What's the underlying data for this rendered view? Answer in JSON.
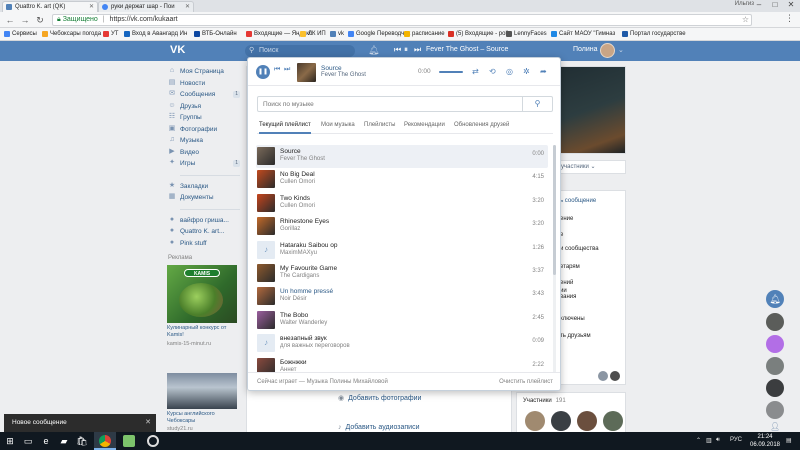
{
  "browser": {
    "tabs": [
      {
        "label": "Quattro K. art (QK)",
        "color": "#5181b8"
      },
      {
        "label": "руки держат шар - Пои",
        "color": "#4285f4"
      }
    ],
    "window_user": "Ильгиз",
    "back_icon": "arrow-left-icon",
    "address": {
      "secure_label": "Защищено",
      "url": "https://vk.com/kukaart"
    },
    "bookmarks": [
      {
        "label": "Сервисы",
        "color": "#4285f4"
      },
      {
        "label": "Чебоксары погода",
        "color": "#f5a623"
      },
      {
        "label": "УТ",
        "color": "#e53935"
      },
      {
        "label": "Вход в Авангард Ин",
        "color": "#1565c0"
      },
      {
        "label": "ВТБ-Онлайн",
        "color": "#0d47a1"
      },
      {
        "label": "Входящие — Яндекс",
        "color": "#e53935"
      },
      {
        "label": "ЛК ИП",
        "color": "#fbc02d"
      },
      {
        "label": "vk",
        "color": "#5181b8"
      },
      {
        "label": "Google Переводчик",
        "color": "#4285f4"
      },
      {
        "label": "расписание",
        "color": "#f4b400"
      },
      {
        "label": "(5) Входящие - polin",
        "color": "#d93025"
      },
      {
        "label": "LennyFaces",
        "color": "#555555"
      },
      {
        "label": "Сайт МАОУ \"Гимназ",
        "color": "#1e88e5"
      },
      {
        "label": "Портал государстве",
        "color": "#1e5aa8"
      }
    ]
  },
  "vk_header": {
    "logo": "VK",
    "search_placeholder": "Поиск",
    "now_playing": "Fever The Ghost – Source",
    "user_name": "Полина"
  },
  "left_menu": {
    "items": [
      {
        "label": "Моя Страница",
        "icon": "home-icon",
        "glyph": "⌂",
        "count": ""
      },
      {
        "label": "Новости",
        "icon": "news-icon",
        "glyph": "▤",
        "count": ""
      },
      {
        "label": "Сообщения",
        "icon": "messages-icon",
        "glyph": "✉",
        "count": "1"
      },
      {
        "label": "Друзья",
        "icon": "friends-icon",
        "glyph": "☺",
        "count": ""
      },
      {
        "label": "Группы",
        "icon": "groups-icon",
        "glyph": "☷",
        "count": ""
      },
      {
        "label": "Фотографии",
        "icon": "photos-icon",
        "glyph": "▣",
        "count": ""
      },
      {
        "label": "Музыка",
        "icon": "music-icon",
        "glyph": "♫",
        "count": ""
      },
      {
        "label": "Видео",
        "icon": "video-icon",
        "glyph": "▶",
        "count": ""
      },
      {
        "label": "Игры",
        "icon": "games-icon",
        "glyph": "✦",
        "count": "1"
      }
    ],
    "items2": [
      {
        "label": "Закладки",
        "icon": "bookmark-icon",
        "glyph": "★"
      },
      {
        "label": "Документы",
        "icon": "documents-icon",
        "glyph": "▦"
      }
    ],
    "items3": [
      {
        "label": "вайфро гриша...",
        "icon": "group-icon",
        "glyph": "●"
      },
      {
        "label": "Quattro K. art...",
        "icon": "group-icon",
        "glyph": "●"
      },
      {
        "label": "Pink stuff",
        "icon": "group-icon",
        "glyph": "●"
      }
    ],
    "ads_label": "Реклама",
    "ad1": {
      "brand": "KAMIS",
      "title": "Кулинарный конкурс от Kamis!",
      "domain": "kamis-15-minut.ru"
    },
    "ad2": {
      "title": "Курсы английского Чебоксары",
      "domain": "study21.ru"
    }
  },
  "background": {
    "add_photos": "Добавить фотографии",
    "add_audio": "Добавить аудиозаписи"
  },
  "group_right": {
    "members_button": "участники",
    "lines": [
      "ь сообщение",
      "ение",
      "е",
      "и сообщества",
      "етарям",
      "ений",
      "ии",
      "вания",
      "ключены",
      "ть друзьям"
    ],
    "members_label": "Участники",
    "members_count": "191"
  },
  "player": {
    "current_title": "Source",
    "current_artist": "Fever The Ghost",
    "current_time": "0:00",
    "progress": 0.0,
    "search_placeholder": "Поиск по музыке",
    "tabs": [
      "Текущий плейлист",
      "Мои музыка",
      "Плейлисты",
      "Рекомендации",
      "Обновления друзей"
    ],
    "tracks": [
      {
        "title": "Source",
        "artist": "Fever The Ghost",
        "duration": "0:00",
        "cover": "#7a6a5a",
        "current": true,
        "note": false,
        "link": false
      },
      {
        "title": "No Big Deal",
        "artist": "Cullen Omori",
        "duration": "4:15",
        "cover": "#c24a1e",
        "current": false,
        "note": false,
        "link": false
      },
      {
        "title": "Two Kinds",
        "artist": "Cullen Omori",
        "duration": "3:20",
        "cover": "#c5451d",
        "current": false,
        "note": false,
        "link": false
      },
      {
        "title": "Rhinestone Eyes",
        "artist": "Gorillaz",
        "duration": "3:20",
        "cover": "#c36a2a",
        "current": false,
        "note": false,
        "link": false
      },
      {
        "title": "Hataraku Saibou op",
        "artist": "MaximMAXyu",
        "duration": "1:26",
        "cover": "",
        "current": false,
        "note": true,
        "link": false
      },
      {
        "title": "My Favourite Game",
        "artist": "The Cardigans",
        "duration": "3:37",
        "cover": "#8e5a2e",
        "current": false,
        "note": false,
        "link": false
      },
      {
        "title": "Un homme pressé",
        "artist": "Noir Désir",
        "duration": "3:43",
        "cover": "#b36a3e",
        "current": false,
        "note": false,
        "link": true
      },
      {
        "title": "The Bobo",
        "artist": "Walter Wanderley",
        "duration": "2:45",
        "cover": "#9a5e9e",
        "current": false,
        "note": false,
        "link": false
      },
      {
        "title": "внезапный звук",
        "artist": "для важных переговоров",
        "duration": "0:09",
        "cover": "",
        "current": false,
        "note": true,
        "link": false
      },
      {
        "title": "Божнжки",
        "artist": "Аннет",
        "duration": "2:22",
        "cover": "#8a4a3e",
        "current": false,
        "note": false,
        "link": false
      }
    ],
    "footer_now_playing": "Сейчас играет — Музыка Полины Михайловой",
    "footer_clear": "Очистить плейлист"
  },
  "toast": {
    "label": "Новое сообщение"
  },
  "taskbar": {
    "lang": "РУС",
    "time": "21:24",
    "date": "06.09.2018"
  }
}
